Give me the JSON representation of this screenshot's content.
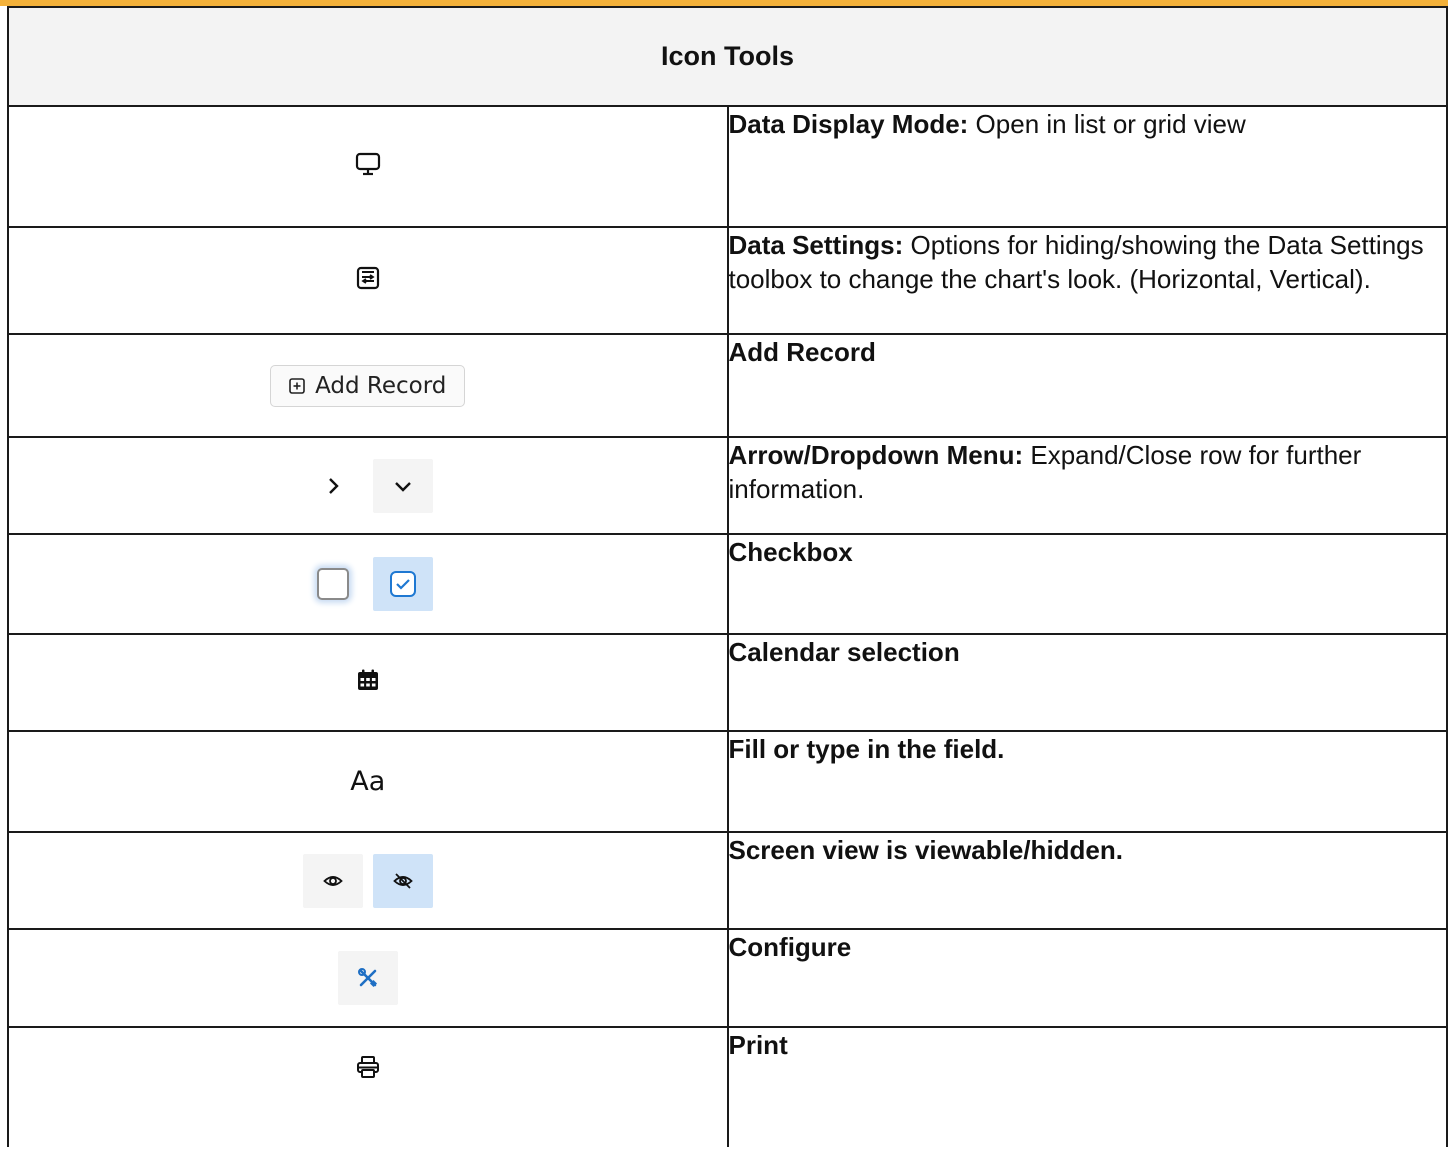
{
  "accent_color": "#f3b13a",
  "table": {
    "title": "Icon Tools",
    "rows": [
      {
        "icon": "monitor-icon",
        "label": "Data Display Mode:",
        "text": " Open in list or grid view"
      },
      {
        "icon": "data-settings-icon",
        "label": "Data Settings:",
        "text": " Options for hiding/showing the Data Settings toolbox to change the chart's look. (Horizontal, Vertical)."
      },
      {
        "icon": "add-record-button",
        "button_label": "Add Record",
        "label": "Add Record",
        "text": ""
      },
      {
        "icon": "chevron-right-icon / chevron-down-icon",
        "label": "Arrow/Dropdown Menu:",
        "text": " Expand/Close row for further information."
      },
      {
        "icon": "checkbox-icon",
        "label": "Checkbox",
        "text": ""
      },
      {
        "icon": "calendar-icon",
        "label": "Calendar selection",
        "text": ""
      },
      {
        "icon": "text-field-icon",
        "icon_text": "Aa",
        "label": "Fill or type in the field.",
        "text": ""
      },
      {
        "icon": "eye-icon / eye-off-icon",
        "label": "Screen view is viewable/hidden.",
        "text": ""
      },
      {
        "icon": "configure-icon",
        "label": "Configure",
        "text": ""
      },
      {
        "icon": "print-icon",
        "label": "Print",
        "text": ""
      }
    ]
  }
}
